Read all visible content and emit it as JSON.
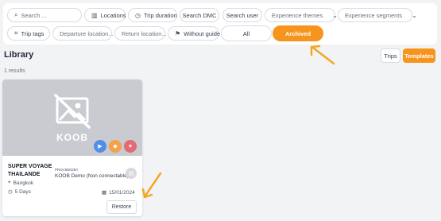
{
  "filters": {
    "search_placeholder": "Search ...",
    "locations": "Locations",
    "trip_duration": "Trip duration",
    "search_dmc": "Search DMC",
    "search_user": "Search user",
    "experience_themes": "Experience themes",
    "experience_segments": "Experience segments",
    "trip_tags": "Trip tags",
    "departure_location": "Departure location...",
    "return_location": "Return location...",
    "without_guide": "Without guide",
    "all": "All",
    "archived": "Archived"
  },
  "library": {
    "title": "Library",
    "results": "1 results",
    "toggle_trips": "Trips",
    "toggle_templates": "Templates"
  },
  "card": {
    "logo_text": "KOOB",
    "trip_name": "SUPER VOYAGE THAILANDE",
    "provided_by_label": "PROVIDEDBY",
    "provider_name": "KOOB Demo (Non connectable)",
    "location": "Bangkok",
    "duration": "5 Days",
    "date": "15/01/2024",
    "restore_label": "Restore"
  },
  "colors": {
    "accent": "#f7941d",
    "arrow": "#f5a623",
    "badge_blue": "#4f8fe8",
    "badge_orange": "#f5a04a",
    "badge_red": "#e26b74"
  }
}
